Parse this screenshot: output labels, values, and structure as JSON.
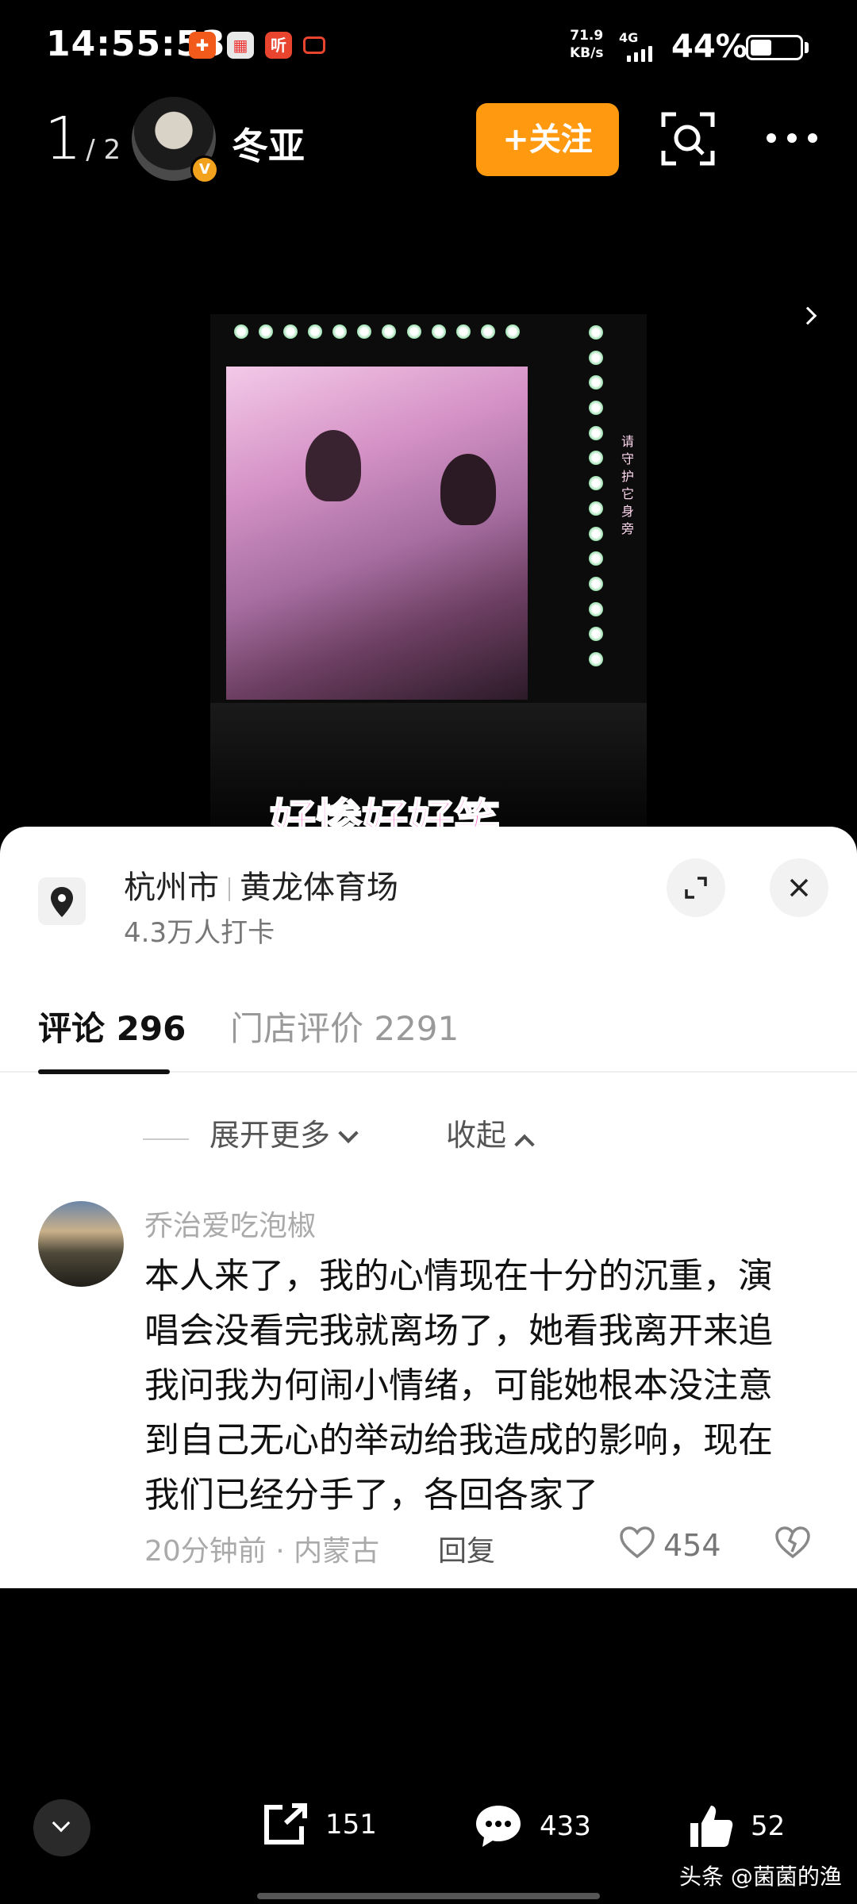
{
  "status_bar": {
    "time": "14:55:53",
    "app_icons": [
      "shopping-icon",
      "calendar-icon",
      "listen-icon",
      "video-icon"
    ],
    "app_icon_3_text": "听",
    "net_speed_value": "71.9",
    "net_speed_unit": "KB/s",
    "network": "4G",
    "battery_percent": "44%",
    "battery_level": 0.44
  },
  "top_bar": {
    "page_current": "1",
    "page_total": "/ 2",
    "username": "冬亚",
    "verified_badge": "V",
    "follow_label": "+关注"
  },
  "media": {
    "side_caption": "请守护它身旁",
    "subtitle": "好惨好好笑"
  },
  "sheet": {
    "location_city": "杭州市",
    "location_venue": "黄龙体育场",
    "checkins": "4.3万人打卡",
    "tabs": [
      {
        "label": "评论 296",
        "active": true
      },
      {
        "label": "门店评价 2291",
        "active": false
      }
    ],
    "expand_more": "展开更多",
    "collapse": "收起",
    "comment": {
      "author": "乔治爱吃泡椒",
      "text": "本人来了，我的心情现在十分的沉重，演唱会没看完我就离场了，她看我离开来追我问我为何闹小情绪，可能她根本没注意到自己无心的举动给我造成的影响，现在我们已经分手了，各回各家了",
      "meta": "20分钟前 · 内蒙古",
      "reply": "回复",
      "likes": "454"
    }
  },
  "bottom_bar": {
    "share_count": "151",
    "comment_count": "433",
    "like_count": "52",
    "watermark": "头条 @菌菌的渔"
  },
  "colors": {
    "accent_follow": "#ff9a10",
    "subtitle_pink": "#ff66c4"
  }
}
